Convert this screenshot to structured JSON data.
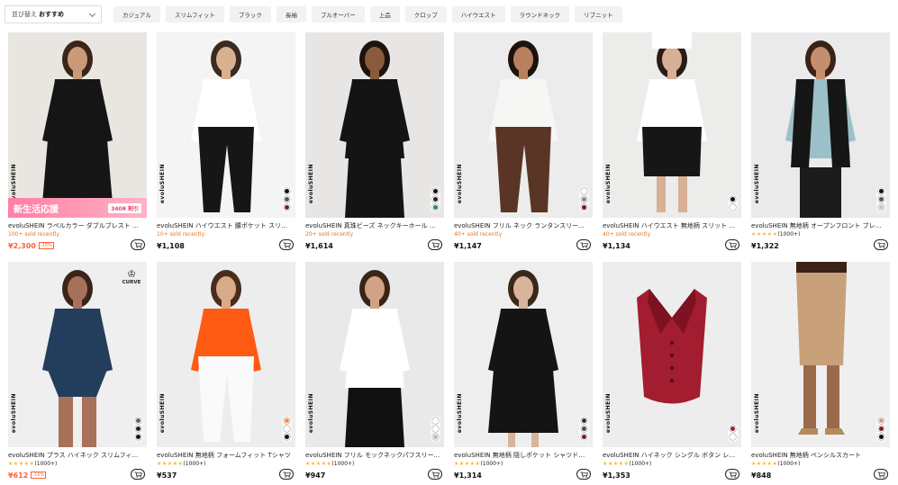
{
  "sort": {
    "label": "並び替え",
    "value": "おすすめ"
  },
  "chips": [
    "カジュアル",
    "スリムフィット",
    "ブラック",
    "長袖",
    "プルオーバー",
    "上品",
    "クロップ",
    "ハイウエスト",
    "ラウンドネック",
    "リブニット"
  ],
  "colors": {
    "accent": "#fa6338",
    "sold": "#e8741b",
    "star": "#fdb62f"
  },
  "products": [
    {
      "brand": "evoluSHEIN",
      "title": "evoluSHEIN ラペルカラー ダブルブレスト ブレザードレス",
      "meta": "100+ sold recently",
      "price": "¥2,300",
      "discount": "-15%",
      "promo": {
        "label": "新生活応援",
        "badge": "340¥ 割引"
      },
      "swatches": []
    },
    {
      "brand": "evoluSHEIN",
      "title": "evoluSHEIN ハイウエスト 腰ポケット スリットパンツ",
      "meta": "10+ sold recently",
      "price": "¥1,108",
      "swatches": [
        "#111",
        "#555",
        "#7a1a2a"
      ]
    },
    {
      "brand": "evoluSHEIN",
      "title": "evoluSHEIN 真珠ビーズ ネックキーホール ブラウス",
      "meta": "20+ sold recently",
      "price": "¥1,614",
      "swatches": [
        "#111",
        "#222",
        "#2f7f7e"
      ]
    },
    {
      "brand": "evoluSHEIN",
      "title": "evoluSHEIN フリル ネック ランタンスリーブ ブラウス",
      "meta": "40+ sold recently",
      "price": "¥1,147",
      "swatches": [
        "#fff",
        "#888",
        "#6a1a2a"
      ]
    },
    {
      "brand": "evoluSHEIN",
      "title": "evoluSHEIN ハイウエスト 無地柄 スリット スカート",
      "meta": "40+ sold recently",
      "price": "¥1,134",
      "swatches": [
        "#111",
        "#fff"
      ]
    },
    {
      "brand": "evoluSHEIN",
      "title": "evoluSHEIN 無地柄 オープンフロント ブレイザー",
      "rating": "(1000+)",
      "price": "¥1,322",
      "swatches": [
        "#111",
        "#555",
        "#d9c3a8"
      ]
    },
    {
      "brand": "evoluSHEIN",
      "title": "evoluSHEIN プラス ハイネック スリムフィット ボディスーツ",
      "rating": "(1000+)",
      "price": "¥612",
      "discount": "-15%",
      "priceRed": true,
      "curve": "CURVE",
      "swatches": [
        "#666",
        "#222",
        "#111"
      ]
    },
    {
      "brand": "evoluSHEIN",
      "title": "evoluSHEIN 無地柄 フォームフィット Tシャツ",
      "rating": "(1000+)",
      "price": "¥537",
      "swatches": [
        "#ff8a3d",
        "#fff",
        "#111"
      ]
    },
    {
      "brand": "evoluSHEIN",
      "title": "evoluSHEIN フリル モックネックパフスリーブ ブラウス",
      "rating": "(1000+)",
      "price": "¥947",
      "swatches": [
        "#fff",
        "#fff",
        "#bbb"
      ]
    },
    {
      "brand": "evoluSHEIN",
      "title": "evoluSHEIN 無地柄 隠しポケット シャツドレス",
      "rating": "(1000+)",
      "price": "¥1,314",
      "swatches": [
        "#333",
        "#4a4a4a",
        "#7a1a2a"
      ]
    },
    {
      "brand": "evoluSHEIN",
      "title": "evoluSHEIN ハイネック シングル ボタン レディース ベスト",
      "rating": "(1000+)",
      "price": "¥1,353",
      "swatches": [
        "#a11d2f",
        "#fff"
      ]
    },
    {
      "brand": "evoluSHEIN",
      "title": "evoluSHEIN 無地柄 ペンシルスカート",
      "rating": "(1000+)",
      "price": "¥848",
      "swatches": [
        "#c9a27a",
        "#7a1a2a",
        "#111"
      ]
    }
  ],
  "stars": "★★★★★"
}
